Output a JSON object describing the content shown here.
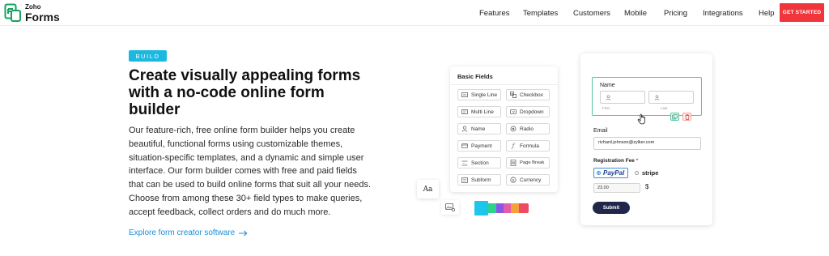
{
  "header": {
    "logo_small": "Zoho",
    "logo_large": "Forms",
    "nav": [
      "Features",
      "Templates",
      "Customers",
      "Mobile",
      "Pricing",
      "Integrations",
      "Help"
    ],
    "cta_label": "GET STARTED"
  },
  "hero": {
    "badge": "BUILD",
    "title": "Create visually appealing forms with a no-code online form builder",
    "description": "Our feature-rich, free online form builder helps you create beautiful, functional forms using customizable themes, situation-specific templates, and a dynamic and simple user interface. Our form builder comes with free and paid fields that can be used to build online forms that suit all your needs. Choose from among these 30+ field types to make queries, accept feedback, collect orders and do much more.",
    "explore_link": "Explore form creator software"
  },
  "basic_fields": {
    "title": "Basic Fields",
    "fields": [
      {
        "label": "Single Line",
        "icon": "single-line-icon"
      },
      {
        "label": "Checkbox",
        "icon": "checkbox-icon"
      },
      {
        "label": "Multi Line",
        "icon": "multi-line-icon"
      },
      {
        "label": "Dropdown",
        "icon": "dropdown-icon"
      },
      {
        "label": "Name",
        "icon": "user-icon"
      },
      {
        "label": "Radio",
        "icon": "radio-icon"
      },
      {
        "label": "Payment",
        "icon": "payment-icon"
      },
      {
        "label": "Formula",
        "icon": "formula-icon"
      },
      {
        "label": "Section",
        "icon": "section-icon"
      },
      {
        "label": "Page Break",
        "icon": "page-break-icon"
      },
      {
        "label": "Subform",
        "icon": "subform-icon"
      },
      {
        "label": "Currency",
        "icon": "currency-icon"
      }
    ]
  },
  "tools": {
    "font_label": "Aa",
    "swatches": [
      "#1ec6ea",
      "#2bd48a",
      "#8a56e8",
      "#e35ea8",
      "#f3a13b",
      "#f04a63"
    ]
  },
  "form": {
    "name_label": "Name",
    "first_label": "First",
    "last_label": "Last",
    "email_label": "Email",
    "email_value": "richard.johnson@zylker.com",
    "reg_fee_label": "Registration Fee",
    "required_mark": "*",
    "paypal_label": "PayPal",
    "stripe_label": "stripe",
    "amount_value": "23.00",
    "currency_symbol": "$",
    "submit_label": "Submit"
  },
  "colors": {
    "accent_red": "#f0353b",
    "badge_blue": "#1bb8e0",
    "link_blue": "#1a8fd6",
    "selection_green": "#56c6a5",
    "submit_navy": "#22264a"
  }
}
